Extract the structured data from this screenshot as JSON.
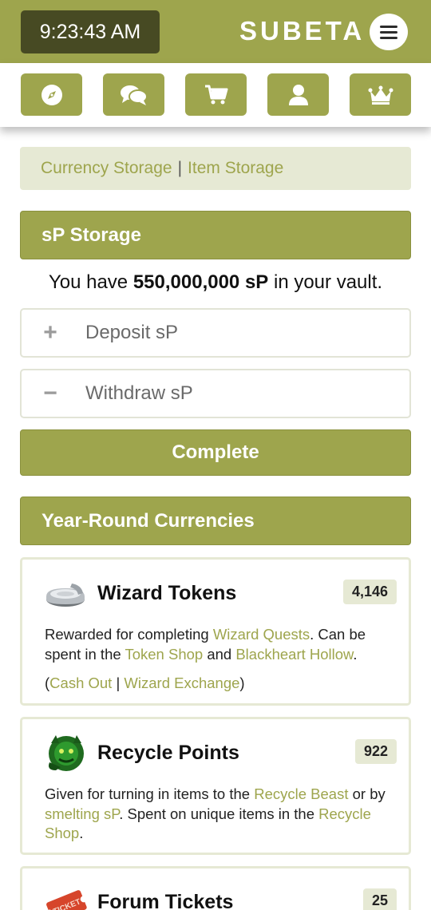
{
  "header": {
    "clock": "9:23:43 AM",
    "brand": "SUBETA",
    "menu_icon": "hamburger-menu-icon"
  },
  "nav": {
    "items": [
      {
        "icon": "compass-icon"
      },
      {
        "icon": "chat-bubbles-icon"
      },
      {
        "icon": "shopping-cart-icon"
      },
      {
        "icon": "user-icon"
      },
      {
        "icon": "crown-icon"
      }
    ]
  },
  "tabs": {
    "currency_storage": "Currency Storage",
    "separator": "|",
    "item_storage": "Item Storage"
  },
  "sp_storage": {
    "title": "sP Storage",
    "vault_prefix": "You have",
    "vault_amount": "550,000,000 sP",
    "vault_suffix": "in your vault.",
    "deposit_placeholder": "Deposit sP",
    "withdraw_placeholder": "Withdraw sP",
    "deposit_sign": "+",
    "withdraw_sign": "−",
    "complete_label": "Complete"
  },
  "year_round": {
    "title": "Year-Round Currencies",
    "cards": [
      {
        "title": "Wizard Tokens",
        "count": "4,146",
        "icon": "wizard-token-icon",
        "desc_1": "Rewarded for completing",
        "link_1": "Wizard Quests",
        "desc_2": ". Can be spent in the",
        "link_2": "Token Shop",
        "desc_3": "and",
        "link_3": "Blackheart Hollow",
        "desc_4": ".",
        "paren_open": "(",
        "action_1": "Cash Out",
        "action_sep": "|",
        "action_2": "Wizard Exchange",
        "paren_close": ")"
      },
      {
        "title": "Recycle Points",
        "count": "922",
        "icon": "recycle-beast-icon",
        "desc_1": "Given for turning in items to the",
        "link_1": "Recycle Beast",
        "desc_2": "or by",
        "link_2": "smelting sP",
        "desc_3": ". Spent on unique items in the",
        "link_3": "Recycle Shop",
        "desc_4": "."
      },
      {
        "title": "Forum Tickets",
        "count": "25",
        "icon": "ticket-icon",
        "icon_text": "TICKET"
      }
    ]
  },
  "colors": {
    "brand_green": "#9ea54d",
    "clock_bg": "#474a23",
    "tab_bg": "#e6e9d4"
  }
}
